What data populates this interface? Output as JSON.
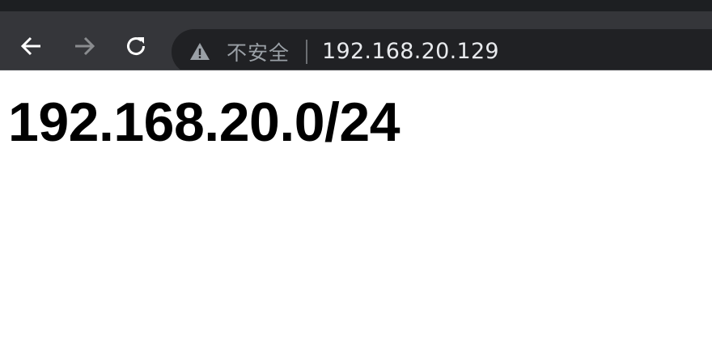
{
  "browser": {
    "toolbar": {
      "back_icon": "arrow-left-icon",
      "forward_icon": "arrow-right-icon",
      "reload_icon": "reload-icon"
    },
    "omnibox": {
      "security_icon": "warning-triangle-icon",
      "security_label": "不安全",
      "url": "192.168.20.129"
    },
    "colors": {
      "toolbar_bg": "#35363a",
      "omnibox_bg": "#202124",
      "url_text": "#e8eaed",
      "security_text": "#9aa0a6"
    }
  },
  "page": {
    "heading": "192.168.20.0/24",
    "background": "#ffffff"
  }
}
